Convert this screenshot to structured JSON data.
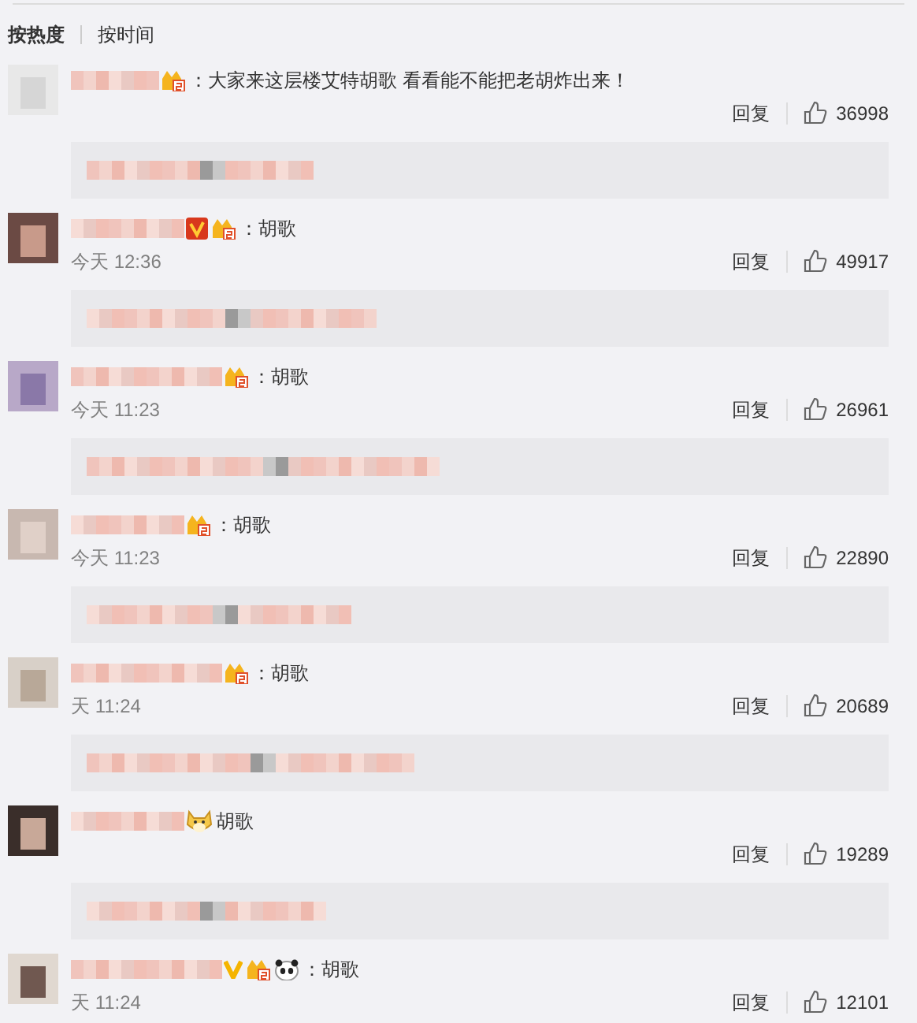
{
  "sort_tabs": [
    {
      "label": "按热度",
      "selected": true
    },
    {
      "label": "按时间",
      "selected": false
    }
  ],
  "comments": [
    {
      "badges": [
        {
          "kind": "member"
        }
      ],
      "text": "：大家来这层楼艾特胡歌 看看能不能把老胡炸出来！",
      "reply_label": "回复",
      "likes": "36998",
      "reply_preview": true
    },
    {
      "badges": [
        {
          "kind": "verified-red"
        },
        {
          "kind": "member"
        }
      ],
      "text": "：胡歌",
      "time": "今天 12:36",
      "reply_label": "回复",
      "likes": "49917",
      "reply_preview": true
    },
    {
      "badges": [
        {
          "kind": "member"
        }
      ],
      "text": "：胡歌",
      "time": "今天 11:23",
      "reply_label": "回复",
      "likes": "26961",
      "reply_preview": true
    },
    {
      "badges": [
        {
          "kind": "member"
        }
      ],
      "text": "：胡歌",
      "time": "今天 11:23",
      "reply_label": "回复",
      "likes": "22890",
      "reply_preview": true
    },
    {
      "badges": [
        {
          "kind": "member"
        }
      ],
      "text": "：胡歌",
      "time": "天 11:24",
      "reply_label": "回复",
      "likes": "20689",
      "reply_preview": true
    },
    {
      "badges": [
        {
          "kind": "dog-emoji"
        }
      ],
      "text": "胡歌",
      "reply_label": "回复",
      "likes": "19289",
      "reply_preview": true
    },
    {
      "badges": [
        {
          "kind": "verified-yellow"
        },
        {
          "kind": "member"
        },
        {
          "kind": "panda-emoji"
        }
      ],
      "text": "：胡歌",
      "time": "天 11:24",
      "reply_label": "回复",
      "likes": "12101",
      "reply_preview": false
    }
  ]
}
